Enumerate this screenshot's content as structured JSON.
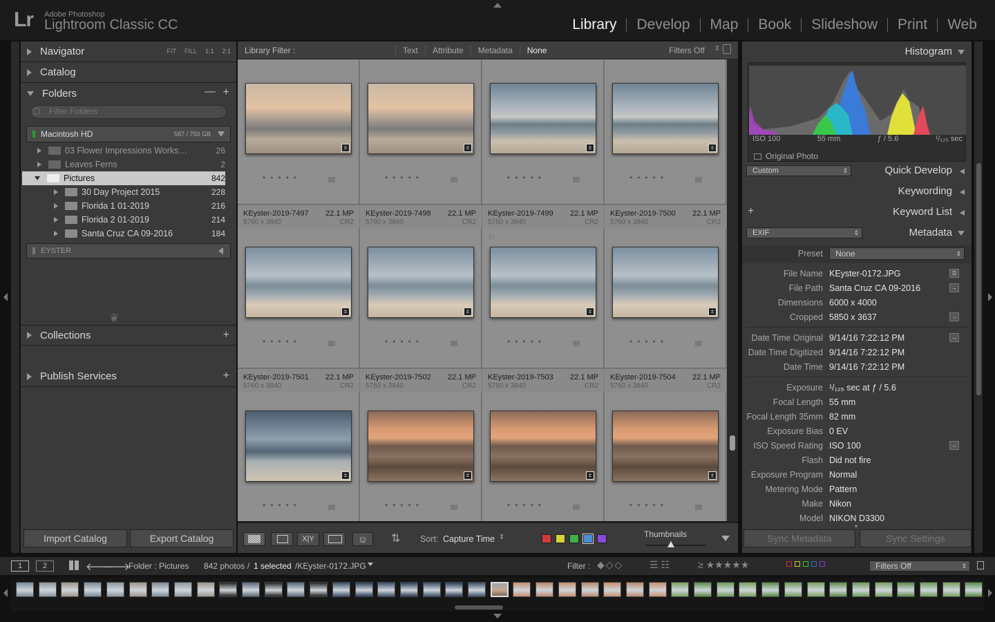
{
  "app": {
    "vendor": "Adobe Photoshop",
    "name": "Lightroom Classic CC",
    "logo": "Lr"
  },
  "modules": [
    {
      "label": "Library",
      "active": true
    },
    {
      "label": "Develop"
    },
    {
      "label": "Map"
    },
    {
      "label": "Book"
    },
    {
      "label": "Slideshow"
    },
    {
      "label": "Print"
    },
    {
      "label": "Web"
    }
  ],
  "left": {
    "navigator": {
      "label": "Navigator",
      "opts": [
        "FIT",
        "FILL",
        "1:1",
        "2:1"
      ]
    },
    "catalog": "Catalog",
    "folders": {
      "label": "Folders",
      "filter_placeholder": "Filter Folders",
      "volume": {
        "name": "Macintosh HD",
        "capacity": "587 / 750 GB"
      },
      "items": [
        {
          "name": "03 Flower Impressions Works…",
          "count": "26",
          "level": 1
        },
        {
          "name": "Leaves Ferns",
          "count": "2",
          "level": 1
        },
        {
          "name": "Pictures",
          "count": "842",
          "level": 1,
          "selected": true
        },
        {
          "name": "30 Day Project 2015",
          "count": "228",
          "level": 2
        },
        {
          "name": "Florida 1 01-2019",
          "count": "216",
          "level": 2
        },
        {
          "name": "Florida 2 01-2019",
          "count": "214",
          "level": 2
        },
        {
          "name": "Santa Cruz CA 09-2016",
          "count": "184",
          "level": 2
        }
      ],
      "volume2": "EYSTER"
    },
    "collections": "Collections",
    "publish": "Publish Services",
    "import_label": "Import Catalog",
    "export_label": "Export Catalog"
  },
  "filterbar": {
    "title": "Library Filter :",
    "options": [
      "Text",
      "Attribute",
      "Metadata",
      "None"
    ],
    "active": "None",
    "filters_off": "Filters Off"
  },
  "grid": {
    "top_partial": {
      "dims": "5760 x 3840",
      "ext": "CR2"
    },
    "rows": [
      [
        {
          "name": "",
          "mp": "",
          "dims": "",
          "ext": "",
          "thumb": "beach1"
        },
        {
          "name": "",
          "mp": "",
          "dims": "",
          "ext": "",
          "thumb": "beach1"
        },
        {
          "name": "",
          "mp": "",
          "dims": "",
          "ext": "",
          "thumb": "beach2"
        },
        {
          "name": "",
          "mp": "",
          "dims": "",
          "ext": "",
          "thumb": "beach2"
        }
      ],
      [
        {
          "name": "KEyster-2019-7497",
          "mp": "22.1 MP",
          "dims": "5760 x 3840",
          "ext": "CR2",
          "thumb": "beach3"
        },
        {
          "name": "KEyster-2019-7498",
          "mp": "22.1 MP",
          "dims": "5760 x 3840",
          "ext": "CR2",
          "thumb": "beach3"
        },
        {
          "name": "KEyster-2019-7499",
          "mp": "22.1 MP",
          "dims": "5760 x 3840",
          "ext": "CR2",
          "thumb": "beach3"
        },
        {
          "name": "KEyster-2019-7500",
          "mp": "22.1 MP",
          "dims": "5760 x 3840",
          "ext": "CR2",
          "thumb": "beach3"
        }
      ],
      [
        {
          "name": "KEyster-2019-7501",
          "mp": "22.1 MP",
          "dims": "5760 x 3840",
          "ext": "CR2",
          "thumb": "beach4"
        },
        {
          "name": "KEyster-2019-7502",
          "mp": "22.1 MP",
          "dims": "5760 x 3840",
          "ext": "CR2",
          "thumb": "sunset"
        },
        {
          "name": "KEyster-2019-7503",
          "mp": "22.1 MP",
          "dims": "5760 x 3840",
          "ext": "CR2",
          "thumb": "sunset"
        },
        {
          "name": "KEyster-2019-7504",
          "mp": "22.1 MP",
          "dims": "5760 x 3840",
          "ext": "CR2",
          "thumb": "sunset"
        }
      ]
    ]
  },
  "toolbar": {
    "sort_label": "Sort:",
    "sort_value": "Capture Time",
    "thumbnails_label": "Thumbnails",
    "color_labels": [
      "#d23a3a",
      "#d8d23a",
      "#3fb04a",
      "#4a8fd8",
      "#8a4ad8"
    ]
  },
  "right": {
    "histogram": {
      "label": "Histogram",
      "iso": "ISO 100",
      "focal": "55 mm",
      "aperture": "ƒ / 5.6",
      "shutter": "¹/₁₂₅ sec",
      "original_photo": "Original Photo"
    },
    "quick_develop": {
      "label": "Quick Develop",
      "preset": "Custom"
    },
    "keywording": "Keywording",
    "keyword_list": "Keyword List",
    "metadata": {
      "label": "Metadata",
      "view": "EXIF",
      "preset_label": "Preset",
      "preset_value": "None",
      "fields": [
        {
          "k": "File Name",
          "v": "KEyster-0172.JPG"
        },
        {
          "k": "File Path",
          "v": "Santa Cruz CA 09-2016"
        },
        {
          "k": "Dimensions",
          "v": "6000 x 4000"
        },
        {
          "k": "Cropped",
          "v": "5850 x 3637"
        },
        {
          "k": "Date Time Original",
          "v": "9/14/16 7:22:12 PM"
        },
        {
          "k": "Date Time Digitized",
          "v": "9/14/16 7:22:12 PM"
        },
        {
          "k": "Date Time",
          "v": "9/14/16 7:22:12 PM"
        },
        {
          "k": "Exposure",
          "v": "¹/₁₂₅ sec at ƒ / 5.6"
        },
        {
          "k": "Focal Length",
          "v": "55 mm"
        },
        {
          "k": "Focal Length 35mm",
          "v": "82 mm"
        },
        {
          "k": "Exposure Bias",
          "v": "0 EV"
        },
        {
          "k": "ISO Speed Rating",
          "v": "ISO 100"
        },
        {
          "k": "Flash",
          "v": "Did not fire"
        },
        {
          "k": "Exposure Program",
          "v": "Normal"
        },
        {
          "k": "Metering Mode",
          "v": "Pattern"
        },
        {
          "k": "Make",
          "v": "Nikon"
        },
        {
          "k": "Model",
          "v": "NIKON D3300"
        }
      ]
    },
    "sync_metadata": "Sync Metadata",
    "sync_settings": "Sync Settings"
  },
  "statusbar": {
    "screen1": "1",
    "screen2": "2",
    "folder": "Folder : Pictures",
    "count": "842 photos /",
    "selected": "1 selected",
    "file": "/KEyster-0172.JPG",
    "filter_label": "Filter :",
    "filters_off": "Filters Off"
  }
}
